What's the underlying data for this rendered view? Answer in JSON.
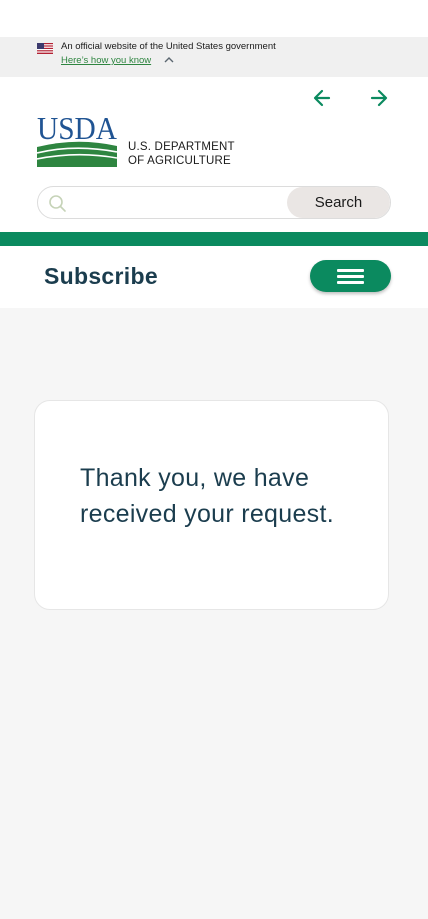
{
  "gov_banner": {
    "text": "An official website of the United States government",
    "link": "Here’s how you know"
  },
  "header": {
    "logo_text": "USDA",
    "agency_line1": "U.S. DEPARTMENT",
    "agency_line2": "OF AGRICULTURE"
  },
  "search": {
    "placeholder": "",
    "value": "",
    "button_label": "Search"
  },
  "subnav": {
    "title": "Subscribe"
  },
  "confirmation": {
    "message": "Thank you, we have received your request."
  },
  "colors": {
    "brand_green": "#0b8a5f",
    "navy": "#1b3d4e",
    "usda_blue": "#205493"
  }
}
